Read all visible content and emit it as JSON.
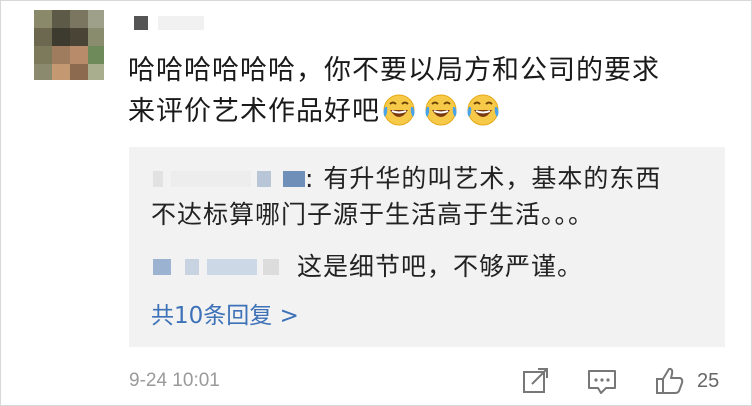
{
  "comment": {
    "username_obscured": true,
    "text_line1": "哈哈哈哈哈哈，你不要以局方和公司的要求",
    "text_line2": "来评价艺术作品好吧",
    "emojis": [
      "laugh-cry-emoji",
      "laugh-cry-emoji",
      "laugh-cry-emoji"
    ]
  },
  "replies": [
    {
      "author_obscured": true,
      "separator": ": ",
      "text_line1": "有升华的叫艺术，基本的东西",
      "text_line2": "不达标算哪门子源于生活高于生活。。。"
    },
    {
      "author_obscured": true,
      "text": "这是细节吧，不够严谨。"
    }
  ],
  "more_replies_label": "共10条回复 >",
  "footer": {
    "timestamp": "9-24 10:01",
    "share_icon": "share-icon",
    "comment_icon": "comment-icon",
    "like_icon": "thumbs-up-icon",
    "like_count": "25"
  }
}
